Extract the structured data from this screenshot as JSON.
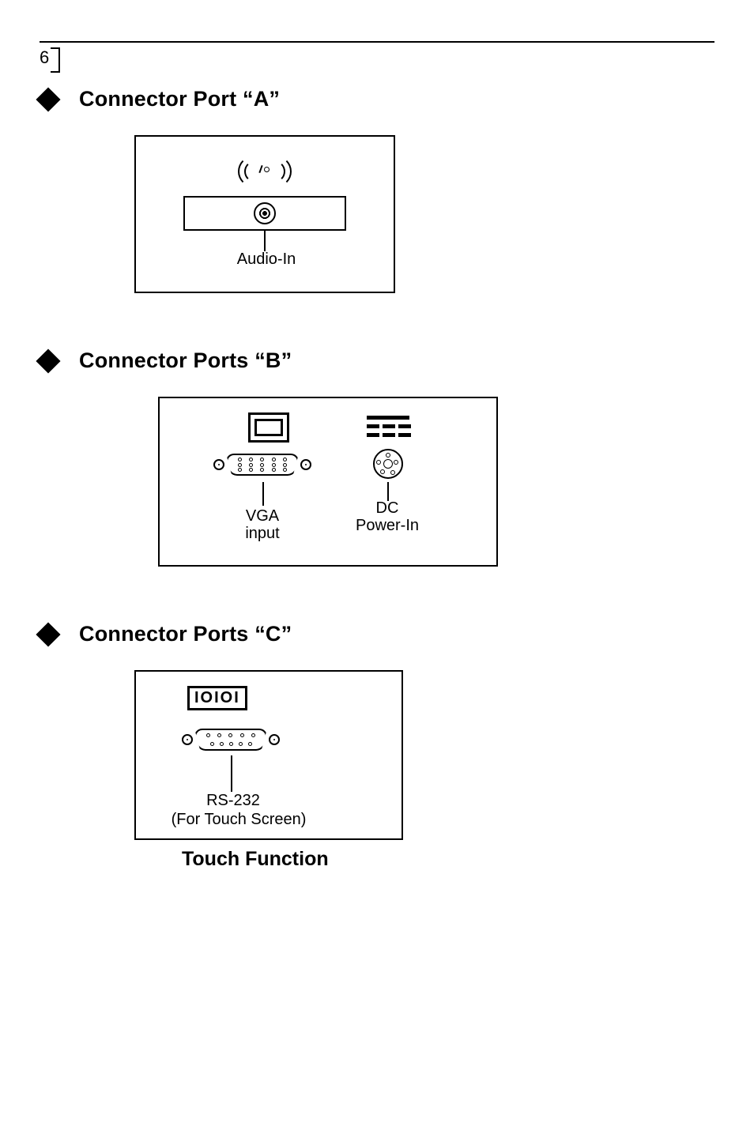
{
  "page_number": "6",
  "sections": {
    "a": {
      "title": "Connector Port “A”",
      "label_audio": "Audio-In"
    },
    "b": {
      "title": "Connector Ports “B”",
      "label_vga_line1": "VGA",
      "label_vga_line2": "input",
      "label_dc_line1": "DC",
      "label_dc_line2": "Power-In"
    },
    "c": {
      "title": "Connector Ports “C”",
      "label_rs232_line1": "RS-232",
      "label_rs232_line2": "(For Touch Screen)",
      "ioioi_text": "IOIOI"
    }
  },
  "subheading": "Touch Function"
}
